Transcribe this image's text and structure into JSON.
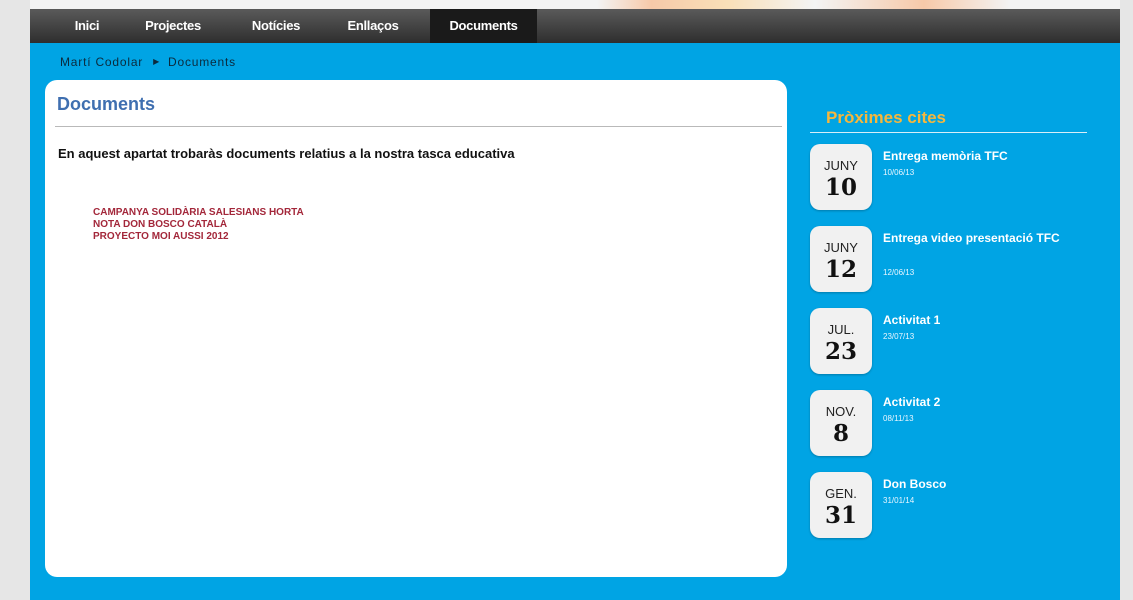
{
  "nav": {
    "items": [
      {
        "label": "Inici"
      },
      {
        "label": "Projectes"
      },
      {
        "label": "Notícies"
      },
      {
        "label": "Enllaços"
      },
      {
        "label": "Documents",
        "active": true
      }
    ]
  },
  "breadcrumb": {
    "home": "Martí Codolar",
    "separator": "▶",
    "current": "Documents"
  },
  "main": {
    "title": "Documents",
    "intro": "En aquest apartat trobaràs documents relatius a la nostra tasca educativa",
    "documents": [
      {
        "label": "CAMPANYA SOLIDÀRIA SALESIANS HORTA"
      },
      {
        "label": "NOTA DON BOSCO CATALÀ"
      },
      {
        "label": "PROYECTO MOI AUSSI 2012"
      }
    ]
  },
  "sidebar": {
    "title": "Pròximes cites",
    "events": [
      {
        "month": "JUNY",
        "day": "10",
        "title": "Entrega memòria TFC",
        "date": "10/06/13"
      },
      {
        "month": "JUNY",
        "day": "12",
        "title": "Entrega video presentació TFC",
        "date": "12/06/13"
      },
      {
        "month": "JUL.",
        "day": "23",
        "title": "Activitat 1",
        "date": "23/07/13"
      },
      {
        "month": "NOV.",
        "day": "8",
        "title": "Activitat 2",
        "date": "08/11/13"
      },
      {
        "month": "GEN.",
        "day": "31",
        "title": "Don Bosco",
        "date": "31/01/14"
      }
    ]
  },
  "colors": {
    "background": "#00a4e4",
    "sidebar_title": "#f6b73c",
    "doc_link": "#a3273a",
    "main_title": "#3f6fb0"
  }
}
